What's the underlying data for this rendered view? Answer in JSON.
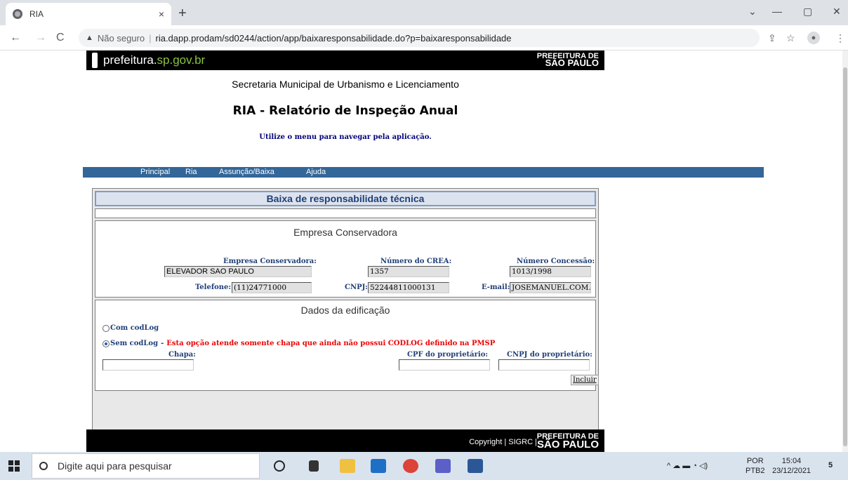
{
  "browser": {
    "tab_title": "RIA",
    "new_tab": "+",
    "tab_close": "×",
    "security_label": "Não seguro",
    "url": "ria.dapp.prodam/sd0244/action/app/baixaresponsabilidade.do?p=baixaresponsabilidade",
    "window_controls": [
      "⌄",
      "—",
      "▢",
      "✕"
    ]
  },
  "header": {
    "logo_text_a": "prefeitura.",
    "logo_text_b": "sp.gov.br",
    "pref_small": "PREFEITURA DE",
    "pref_big": "SÃO PAULO"
  },
  "page": {
    "secretaria": "Secretaria Municipal de Urbanismo e Licenciamento",
    "title": "RIA - Relatório de Inspeção Anual",
    "hint": "Utilize o menu para navegar pela aplicação."
  },
  "menu": [
    "Principal",
    "Ria",
    "Assunção/Baixa",
    "Ajuda"
  ],
  "form": {
    "title": "Baixa de responsabilidate técnica",
    "empresa_section": "Empresa Conservadora",
    "labels": {
      "empresa": "Empresa Conservadora:",
      "crea": "Número do CREA:",
      "concessao": "Número Concessão:",
      "telefone": "Telefone:",
      "cnpj": "CNPJ:",
      "email": "E-mail:"
    },
    "values": {
      "empresa": "ELEVADOR SAO PAULO",
      "crea": "1357",
      "concessao": "1013/1998",
      "telefone": "(11)24771000",
      "cnpj": "52244811000131",
      "email": "JOSEMANUEL.COM.B"
    },
    "edificacao_section": "Dados da edificação",
    "radio_com": "Com codLog",
    "radio_sem": "Sem codLog",
    "radio_sem_dash": "-",
    "radio_sem_warning": "Esta opção atende somente chapa que ainda não possui CODLOG definido na PMSP",
    "chapa_label": "Chapa:",
    "cpf_label": "CPF do proprietário:",
    "cnpj_prop_label": "CNPJ do proprietário:",
    "incluir": "Incluir"
  },
  "footer": {
    "copyright": "Copyright | SIGRC |",
    "pref_small": "PREFEITURA DE",
    "pref_big": "SÃO PAULO"
  },
  "taskbar": {
    "search_placeholder": "Digite aqui para pesquisar",
    "lang_top": "POR",
    "lang_bottom": "PTB2",
    "time": "15:04",
    "date": "23/12/2021",
    "notif_count": "5"
  }
}
